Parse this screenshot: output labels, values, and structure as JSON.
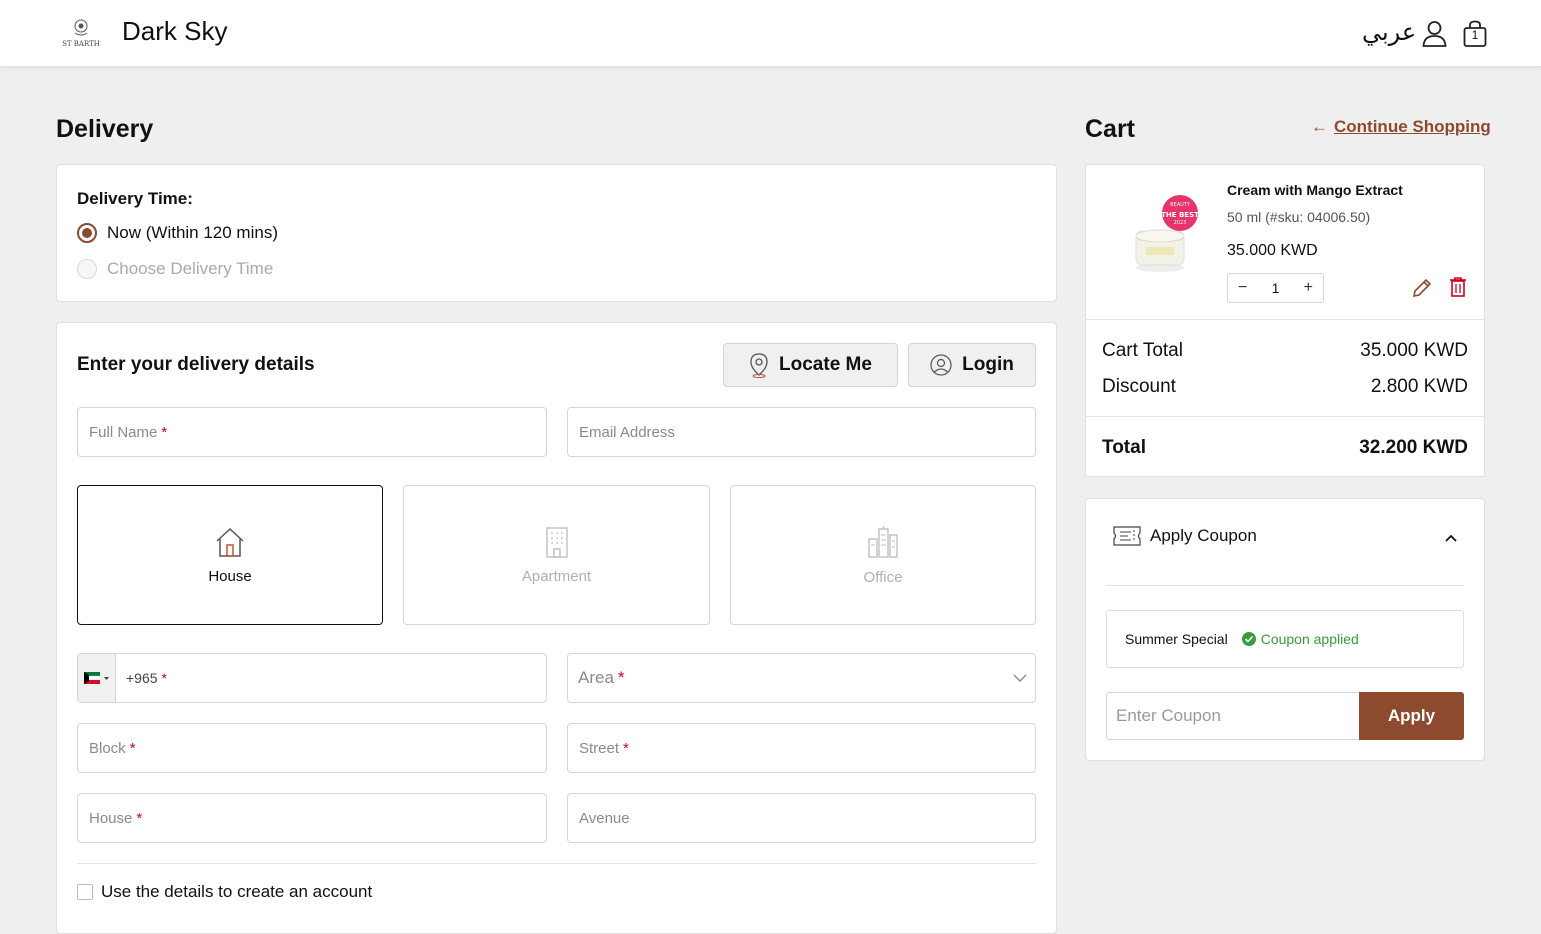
{
  "header": {
    "store_name": "Dark Sky",
    "language_link": "عربي",
    "cart_count": "1"
  },
  "delivery": {
    "title": "Delivery",
    "time_label": "Delivery Time:",
    "time_options": [
      {
        "label": "Now (Within 120 mins)",
        "selected": true
      },
      {
        "label": "Choose Delivery Time",
        "selected": false
      }
    ]
  },
  "details": {
    "title": "Enter your delivery details",
    "locate_button": "Locate Me",
    "login_button": "Login",
    "full_name_placeholder": "Full Name",
    "email_placeholder": "Email Address",
    "address_types": [
      {
        "label": "House",
        "active": true
      },
      {
        "label": "Apartment",
        "active": false
      },
      {
        "label": "Office",
        "active": false
      }
    ],
    "phone_prefix": "+965",
    "area_placeholder": "Area",
    "block_placeholder": "Block",
    "street_placeholder": "Street",
    "house_placeholder": "House",
    "avenue_placeholder": "Avenue",
    "required_mark": "*",
    "create_account_label": "Use the details to create an account"
  },
  "cart": {
    "title": "Cart",
    "continue_link": "Continue Shopping",
    "item": {
      "name": "Cream with Mango Extract",
      "variant": "50 ml (#sku: 04006.50)",
      "price": "35.000 KWD",
      "quantity": "1",
      "qty_minus": "−",
      "qty_plus": "+"
    },
    "summary": {
      "cart_total_label": "Cart Total",
      "cart_total_value": "35.000 KWD",
      "discount_label": "Discount",
      "discount_value": "2.800 KWD",
      "total_label": "Total",
      "total_value": "32.200 KWD"
    },
    "coupon": {
      "toggle_label": "Apply Coupon",
      "applied_name": "Summer Special",
      "applied_status": "Coupon applied",
      "input_placeholder": "Enter Coupon",
      "apply_button": "Apply"
    }
  },
  "colors": {
    "accent": "#8c4a2e",
    "success": "#3a9b3a",
    "required": "#d0021b",
    "background": "#efefef"
  }
}
